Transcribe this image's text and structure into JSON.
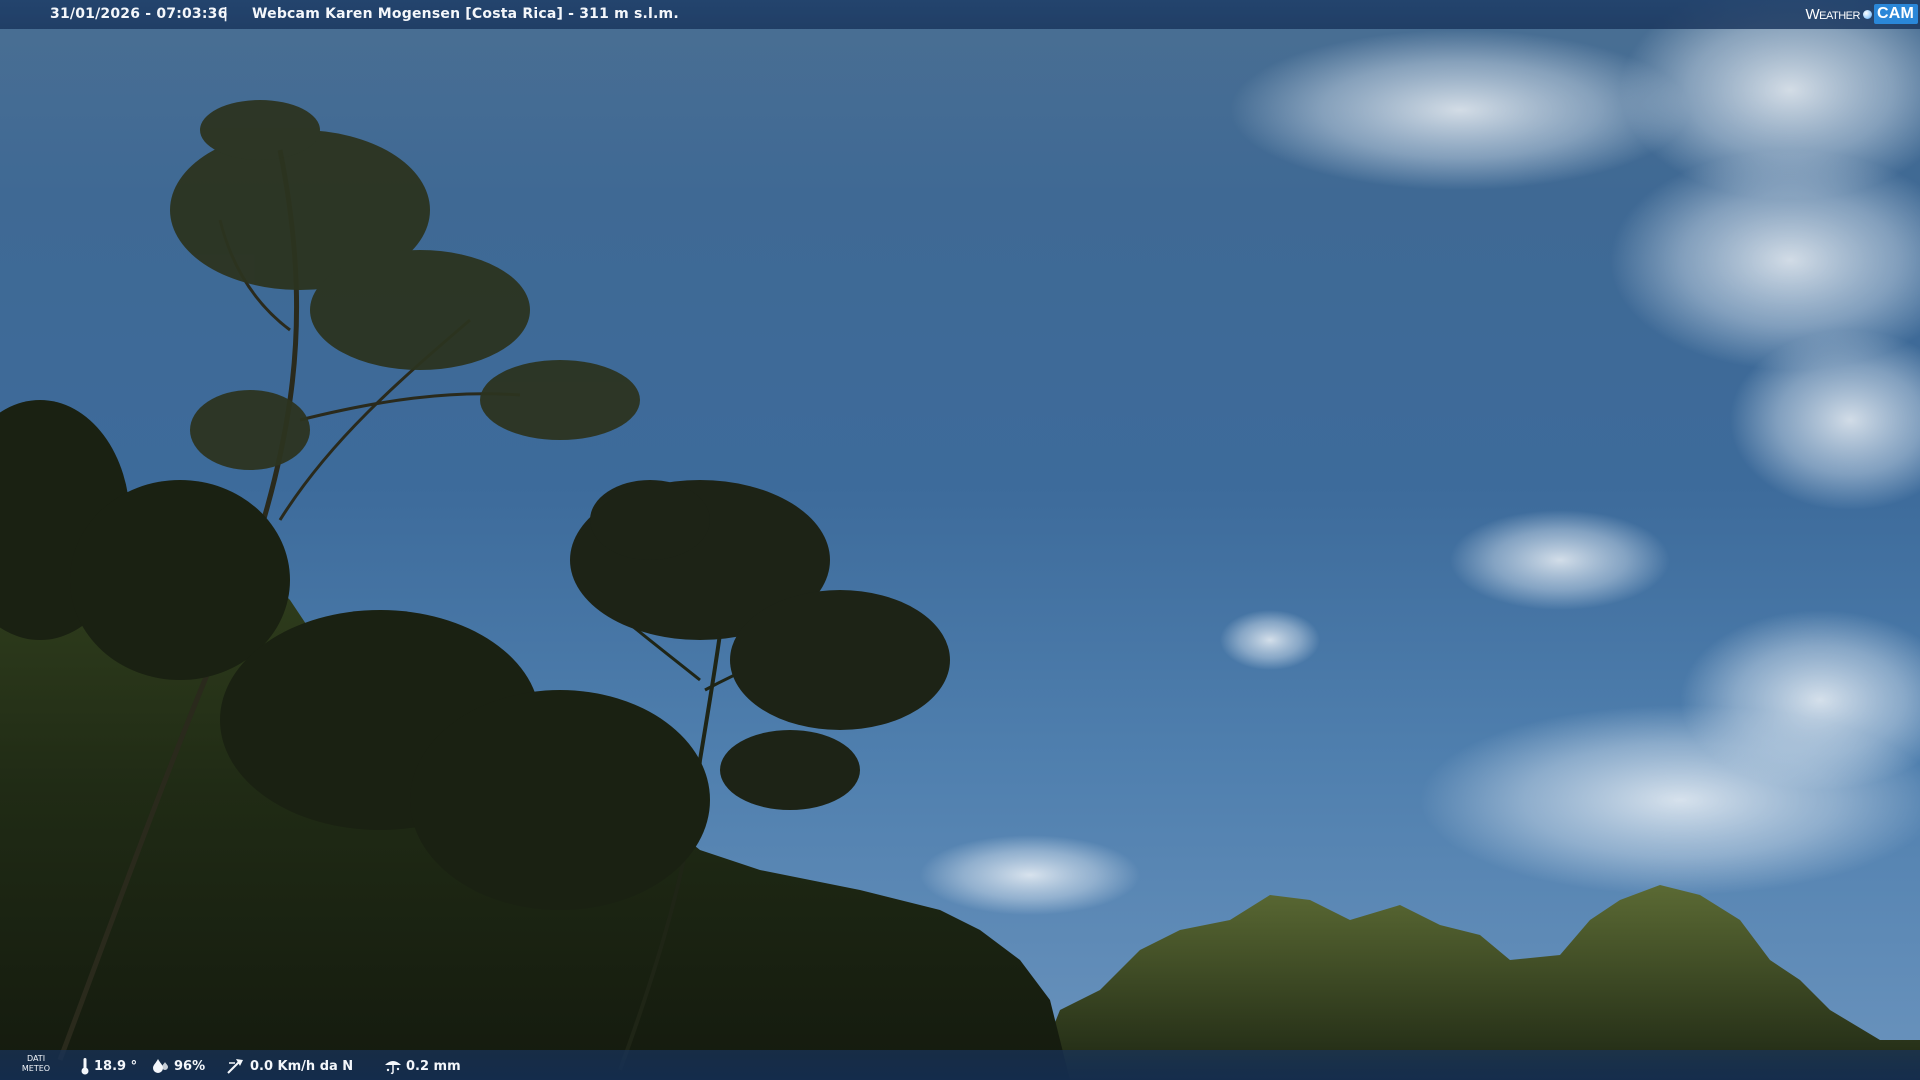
{
  "header": {
    "datetime": "31/01/2026 - 07:03:36",
    "separator": "|",
    "title": "Webcam Karen Mogensen [Costa Rica]  - 311 m s.l.m."
  },
  "logo": {
    "word": "Weather",
    "badge": "CAM"
  },
  "weather_bar": {
    "label_line1": "DATI",
    "label_line2": "METEO",
    "temperature": "18.9 °",
    "humidity": "96%",
    "wind": "0.0 Km/h da N",
    "rain": "0.2 mm"
  },
  "icons": {
    "temperature": "thermometer-icon",
    "humidity": "droplet-icon",
    "wind": "wind-icon",
    "rain": "rain-gauge-icon"
  },
  "colors": {
    "sky": "#3d6b9b",
    "bar": "#1e3e68",
    "vegetation": "#1f2a16",
    "logo_accent": "#2a87d8"
  }
}
